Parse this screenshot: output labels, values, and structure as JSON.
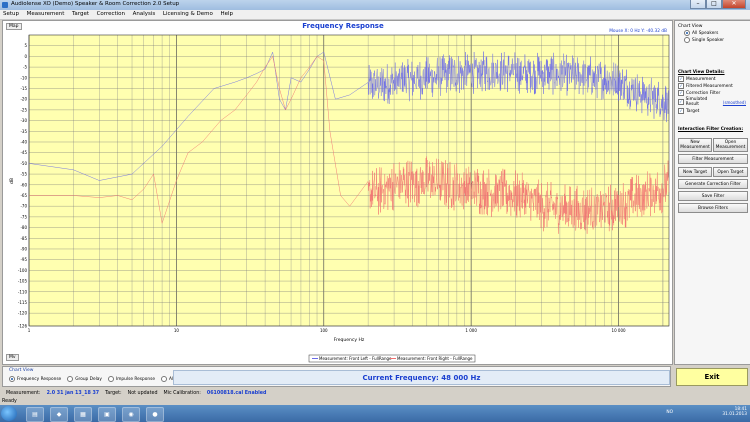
{
  "window": {
    "title": "Audiolense XO (Demo) Speaker & Room Correction 2.0 Setup"
  },
  "menu": [
    "Setup",
    "Measurement",
    "Target",
    "Correction",
    "Analysis",
    "Licensing & Demo",
    "Help"
  ],
  "chart": {
    "tabs": {
      "top": "Map",
      "bottom": "Mv"
    },
    "mouse_readout": "Mouse X: 0 Hz    Y: -40.32 dB",
    "legend": {
      "left": "Measurement: Front Left - FullRange",
      "right": "Measurement: Front Right - FullRange"
    }
  },
  "chart_data": {
    "type": "line",
    "title": "Frequency Response",
    "xlabel": "Frequency Hz",
    "ylabel": "dB",
    "xscale": "log",
    "xlim": [
      1,
      22000
    ],
    "ylim": [
      -126,
      10
    ],
    "x_ticks": [
      {
        "value": 1,
        "label": "1"
      },
      {
        "value": 10,
        "label": "10"
      },
      {
        "value": 100,
        "label": "100"
      },
      {
        "value": 1000,
        "label": "1 000"
      },
      {
        "value": 10000,
        "label": "10 000"
      }
    ],
    "y_ticks": [
      5,
      0,
      -5,
      -10,
      -15,
      -20,
      -25,
      -30,
      -35,
      -40,
      -45,
      -50,
      -55,
      -60,
      -65,
      -70,
      -75,
      -80,
      -85,
      -90,
      -95,
      -100,
      -105,
      -110,
      -115,
      -120,
      -126
    ],
    "grid": true,
    "background": "#ffffb0",
    "series": [
      {
        "name": "Measurement: Front Left - FullRange",
        "color": "#6a6ae8",
        "noisy_above_hz": 200,
        "x": [
          1,
          2,
          3,
          5,
          8,
          12,
          18,
          25,
          30,
          35,
          40,
          45,
          50,
          55,
          60,
          70,
          80,
          90,
          100,
          120,
          150,
          200,
          300,
          500,
          800,
          1500,
          3000,
          6000,
          10000,
          15000,
          22000
        ],
        "y": [
          -50,
          -53,
          -58,
          -55,
          -42,
          -28,
          -15,
          -12,
          -10,
          -8,
          -6,
          2,
          -20,
          -25,
          -10,
          -12,
          -6,
          0,
          2,
          -20,
          -18,
          -14,
          -12,
          -10,
          -8,
          -7,
          -8,
          -9,
          -12,
          -18,
          -22
        ]
      },
      {
        "name": "Measurement: Front Right - FullRange",
        "color": "#f07070",
        "noisy_above_hz": 200,
        "x": [
          1,
          2,
          3,
          4,
          5,
          6,
          7,
          8,
          10,
          12,
          15,
          20,
          25,
          30,
          35,
          40,
          45,
          50,
          55,
          60,
          70,
          80,
          90,
          100,
          110,
          130,
          150,
          200,
          300,
          500,
          1000,
          2000,
          3000,
          5000,
          8000,
          12000,
          22000
        ],
        "y": [
          -65,
          -65,
          -66,
          -65,
          -67,
          -62,
          -55,
          -78,
          -58,
          -45,
          -40,
          -30,
          -25,
          -18,
          -12,
          -5,
          0,
          -15,
          -25,
          -20,
          -10,
          -5,
          0,
          -2,
          -35,
          -65,
          -70,
          -65,
          -60,
          -58,
          -62,
          -65,
          -70,
          -72,
          -72,
          -68,
          -60
        ]
      }
    ]
  },
  "side_panel": {
    "chart_view_title": "Chart View",
    "chart_view_options": [
      {
        "label": "All Speakers",
        "selected": true
      },
      {
        "label": "Single Speaker",
        "selected": false
      }
    ],
    "details_title": "Chart View Details:",
    "details": [
      {
        "label": "Measurement",
        "checked": true
      },
      {
        "label": "Filtered Measurement",
        "checked": false
      },
      {
        "label": "Correction Filter",
        "checked": false
      },
      {
        "label": "Simulated Result",
        "checked": false,
        "link": "(smoothed)"
      },
      {
        "label": "Target",
        "checked": false
      }
    ],
    "interaction_title": "Interaction Filter Creation:",
    "buttons": {
      "new_measurement": "New Measurement",
      "open_measurement": "Open Measurement",
      "filter_measurement": "Filter Measurement",
      "new_target": "New Target",
      "open_target": "Open Target",
      "generate_correction_filter": "Generate Correction Filter",
      "save_filter": "Save Filter",
      "browse_filters": "Browse Filters"
    }
  },
  "bottom": {
    "chart_view_title": "Chart View",
    "options": [
      {
        "label": "Frequency Response",
        "selected": true
      },
      {
        "label": "Group Delay",
        "selected": false
      },
      {
        "label": "Impulse Response",
        "selected": false
      },
      {
        "label": "All",
        "selected": false
      }
    ],
    "current_frequency": "Current Frequency: 48 000 Hz",
    "exit_label": "Exit"
  },
  "status": {
    "measurement_label": "Measurement:",
    "measurement_value": "2.0 31 jan 13_18 37",
    "target_label": "Target:",
    "target_value": "Not updated",
    "mic_label": "Mic Calibration:",
    "mic_value": "06100818.cal Enabled",
    "ready": "Ready"
  },
  "taskbar": {
    "lang": "NO",
    "time": "18:41",
    "date": "31.01.2013"
  }
}
